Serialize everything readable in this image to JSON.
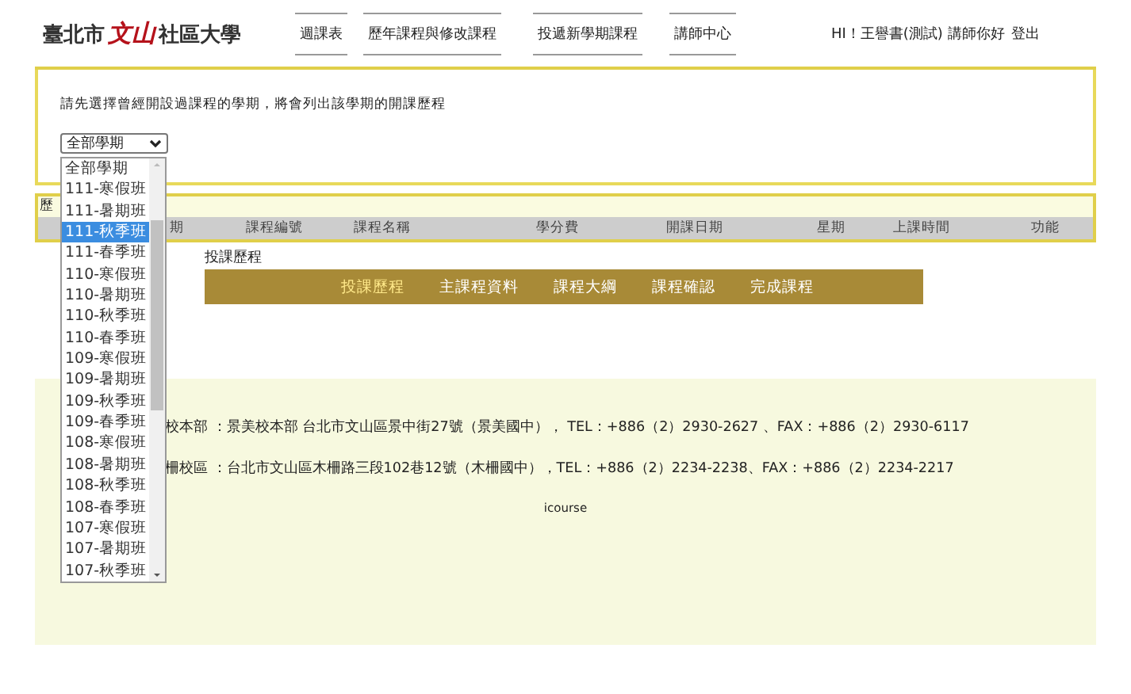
{
  "logo": {
    "city": "臺北市",
    "mark": "文山",
    "school": "社區大學"
  },
  "nav": [
    {
      "label": "週課表"
    },
    {
      "label": "歷年課程與修改課程"
    },
    {
      "label": "投遞新學期課程"
    },
    {
      "label": "講師中心"
    }
  ],
  "user": {
    "greeting": "HI！王譽書(測試) 講師你好",
    "logout": "登出"
  },
  "intro": {
    "text": "請先選擇曾經開設過課程的學期，將會列出該學期的開課歷程",
    "select_value": "全部學期",
    "options": [
      {
        "label": "全部學期",
        "selected": false
      },
      {
        "label": "111-寒假班",
        "selected": false
      },
      {
        "label": "111-暑期班",
        "selected": false
      },
      {
        "label": "111-秋季班",
        "selected": true
      },
      {
        "label": "111-春季班",
        "selected": false
      },
      {
        "label": "110-寒假班",
        "selected": false
      },
      {
        "label": "110-暑期班",
        "selected": false
      },
      {
        "label": "110-秋季班",
        "selected": false
      },
      {
        "label": "110-春季班",
        "selected": false
      },
      {
        "label": "109-寒假班",
        "selected": false
      },
      {
        "label": "109-暑期班",
        "selected": false
      },
      {
        "label": "109-秋季班",
        "selected": false
      },
      {
        "label": "109-春季班",
        "selected": false
      },
      {
        "label": "108-寒假班",
        "selected": false
      },
      {
        "label": "108-暑期班",
        "selected": false
      },
      {
        "label": "108-秋季班",
        "selected": false
      },
      {
        "label": "108-春季班",
        "selected": false
      },
      {
        "label": "107-寒假班",
        "selected": false
      },
      {
        "label": "107-暑期班",
        "selected": false
      },
      {
        "label": "107-秋季班",
        "selected": false
      }
    ]
  },
  "history": {
    "title": "歷",
    "columns": [
      "期",
      "課程編號",
      "課程名稱",
      "學分費",
      "開課日期",
      "星期",
      "上課時間",
      "功能"
    ]
  },
  "steps": {
    "label": "投課歷程",
    "items": [
      {
        "label": "投課歷程",
        "selected": true
      },
      {
        "label": "主課程資料",
        "selected": false
      },
      {
        "label": "課程大綱",
        "selected": false
      },
      {
        "label": "課程確認",
        "selected": false
      },
      {
        "label": "完成課程",
        "selected": false
      }
    ]
  },
  "footer": {
    "lines": [
      "校本部 ：景美校本部 台北市文山區景中街27號（景美國中）， TEL：+886（2）2930-2627 、FAX：+886（2）2930-6117",
      "柵校區 ：台北市文山區木柵路三段102巷12號（木柵國中），TEL：+886（2）2234-2238、FAX：+886（2）2234-2217"
    ],
    "brand": "icourse"
  }
}
